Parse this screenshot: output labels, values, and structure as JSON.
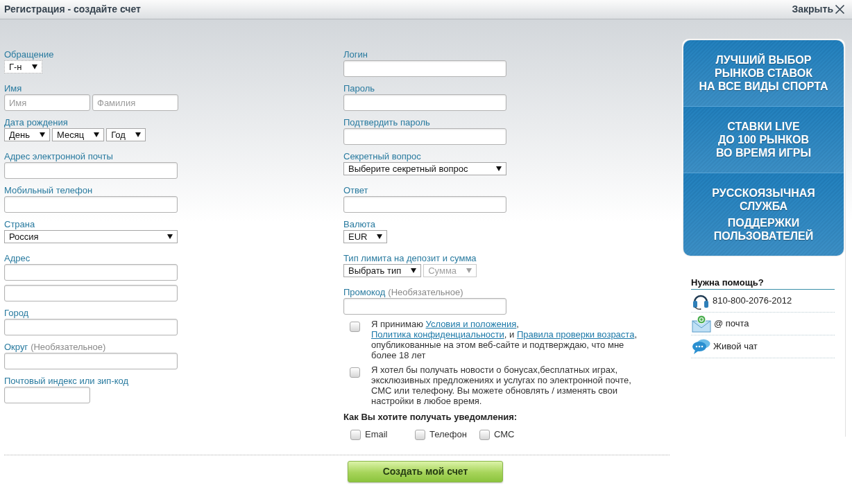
{
  "window": {
    "title": "Регистрация - создайте счет",
    "close_label": "Закрыть"
  },
  "left_fields": [
    {
      "kind": "select",
      "label": "Обращение",
      "selects": [
        {
          "value": "Г-н",
          "focused": true,
          "disabled": false
        }
      ]
    },
    {
      "kind": "input_pair",
      "label": "Имя",
      "placeholders": [
        "Имя",
        "Фамилия"
      ]
    },
    {
      "kind": "select",
      "label": "Дата рождения",
      "selects": [
        {
          "value": "День",
          "focused": false,
          "disabled": false
        },
        {
          "value": "Месяц",
          "focused": false,
          "disabled": false
        },
        {
          "value": "Год",
          "focused": false,
          "disabled": false
        }
      ]
    },
    {
      "kind": "input",
      "label": "Адрес электронной почты"
    },
    {
      "kind": "input",
      "label": "Мобильный телефон"
    },
    {
      "kind": "select_wide",
      "label": "Страна",
      "selects": [
        {
          "value": "Россия",
          "focused": false,
          "disabled": false
        }
      ]
    },
    {
      "kind": "input_double",
      "label": "Адрес"
    },
    {
      "kind": "input",
      "label": "Город"
    },
    {
      "kind": "input",
      "label": "Округ",
      "note": "(Необязательное)"
    },
    {
      "kind": "input_short",
      "label": "Почтовый индекс или зип-код"
    }
  ],
  "right_fields": [
    {
      "kind": "input",
      "label": "Логин"
    },
    {
      "kind": "input",
      "label": "Пароль"
    },
    {
      "kind": "input",
      "label": "Подтвердить пароль"
    },
    {
      "kind": "select_wide",
      "label": "Секретный вопрос",
      "selects": [
        {
          "value": "Выберите секретный вопрос",
          "focused": false,
          "disabled": false
        }
      ]
    },
    {
      "kind": "input",
      "label": "Ответ"
    },
    {
      "kind": "select",
      "label": "Валюта",
      "selects": [
        {
          "value": "EUR",
          "focused": false,
          "disabled": false
        }
      ]
    },
    {
      "kind": "select",
      "label": "Тип лимита на депозит и сумма",
      "selects": [
        {
          "value": "Выбрать тип",
          "focused": false,
          "disabled": false
        },
        {
          "value": "Сумма",
          "focused": false,
          "disabled": true
        }
      ]
    },
    {
      "kind": "input",
      "label": "Промокод",
      "note": "(Необязательное)"
    }
  ],
  "consents": [
    {
      "checked": false,
      "parts": [
        {
          "kind": "text",
          "text": "Я принимаю "
        },
        {
          "kind": "link",
          "text": "Условия и положения"
        },
        {
          "kind": "text",
          "text": ", "
        },
        {
          "kind": "link",
          "text": "Политика конфиденциальности"
        },
        {
          "kind": "text",
          "text": ", и "
        },
        {
          "kind": "link",
          "text": "Правила проверки возраста"
        },
        {
          "kind": "text",
          "text": ", опубликованные на этом веб-сайте и подтверждаю, что мне более 18 лет"
        }
      ]
    },
    {
      "checked": false,
      "parts": [
        {
          "kind": "text",
          "text": "Я хотел бы получать новости о бонусах,бесплатных играх, эксклюзивных предложениях и услугах по электронной почте, СМС или телефону. Вы можете обновлять / изменять свои настройки в любое время."
        }
      ]
    }
  ],
  "notifications": {
    "title": "Как Вы хотите получать уведомления:",
    "options": [
      {
        "label": "Email",
        "checked": false
      },
      {
        "label": "Телефон",
        "checked": false
      },
      {
        "label": "СМС",
        "checked": false
      }
    ]
  },
  "submit_button": "Создать мой счет",
  "promo": {
    "sections": [
      {
        "paragraphs": [
          "ЛУЧШИЙ ВЫБОР\nРЫНКОВ СТАВОК\nНА ВСЕ ВИДЫ СПОРТА"
        ]
      },
      {
        "paragraphs": [
          "СТАВКИ LIVE\nДО 100 РЫНКОВ\nВО ВРЕМЯ ИГРЫ"
        ]
      },
      {
        "paragraphs": [
          "РУССКОЯЗЫЧНАЯ\nСЛУЖБА",
          "ПОДДЕРЖКИ\nПОЛЬЗОВАТЕЛЕЙ"
        ]
      }
    ]
  },
  "help": {
    "title": "Нужна помощь?",
    "items": [
      {
        "kind": "phone",
        "text": "810-800-2076-2012"
      },
      {
        "kind": "email",
        "text": "@ почта"
      },
      {
        "kind": "chat",
        "text": "Живой чат"
      }
    ]
  }
}
